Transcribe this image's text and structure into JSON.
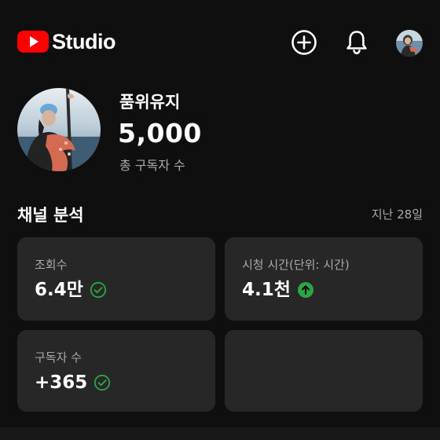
{
  "header": {
    "logo_text": "Studio",
    "brand_color": "#ff0000",
    "icons": [
      "create-icon",
      "notifications-bell-icon",
      "account-avatar"
    ]
  },
  "channel": {
    "name": "품위유지",
    "subscriber_count": "5,000",
    "subscriber_label": "총 구독자 수"
  },
  "analytics": {
    "title": "채널 분석",
    "period": "지난 28일",
    "cards": [
      {
        "label": "조회수",
        "value": "6.4만",
        "status_icon": "check-circle-icon",
        "status_color": "#2ba640"
      },
      {
        "label": "시청 시간(단위: 시간)",
        "value": "4.1천",
        "status_icon": "arrow-up-circle-icon",
        "status_color": "#2ba640"
      },
      {
        "label": "구독자 수",
        "value": "+365",
        "status_icon": "check-circle-icon",
        "status_color": "#2ba640"
      }
    ]
  },
  "colors": {
    "background": "#0f0f0f",
    "card_background": "#272727",
    "secondary_text": "#aaaaaa",
    "positive": "#2ba640"
  }
}
